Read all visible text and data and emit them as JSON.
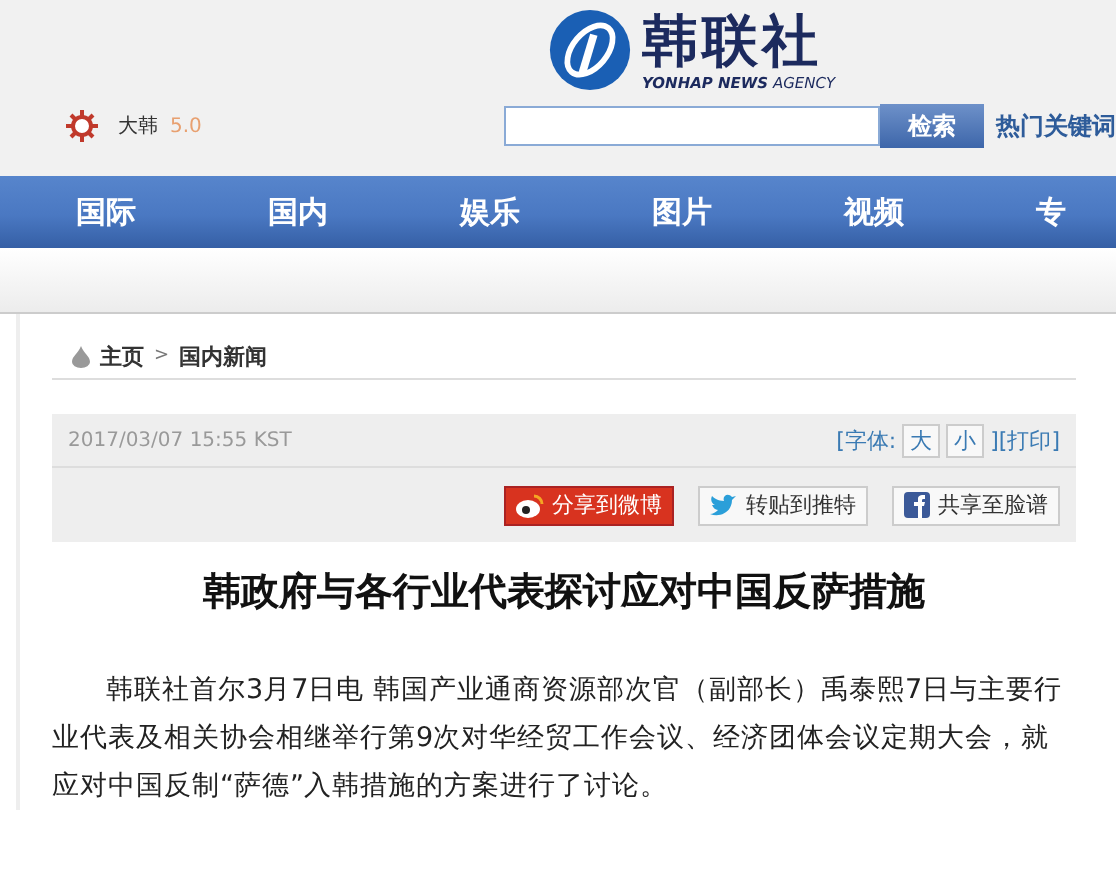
{
  "logo": {
    "name": "韩联社",
    "tagline_bold": "YONHAP NEWS",
    "tagline": "AGENCY"
  },
  "header": {
    "site_label": "大韩",
    "version": "5.0",
    "search": {
      "button": "检索"
    },
    "hot_keywords": "热门关键词"
  },
  "nav": [
    {
      "label": "国际"
    },
    {
      "label": "国内"
    },
    {
      "label": "娱乐"
    },
    {
      "label": "图片"
    },
    {
      "label": "视频"
    },
    {
      "label": "专"
    }
  ],
  "breadcrumb": [
    {
      "label": "主页"
    },
    {
      "label": "国内新闻"
    }
  ],
  "breadcrumb_separator": ">",
  "article": {
    "date": "2017/03/07 15:55 KST",
    "font_tools": {
      "open": "[字体:",
      "large": "大",
      "small": "小",
      "close": "][打印]"
    },
    "share": [
      {
        "kind": "weibo",
        "label": "分享到微博"
      },
      {
        "kind": "twitter",
        "label": "转贴到推特"
      },
      {
        "kind": "facebook",
        "label": "共享至脸谱"
      }
    ],
    "title": "韩政府与各行业代表探讨应对中国反萨措施",
    "body": "韩联社首尔3月7日电 韩国产业通商资源部次官（副部长）禹泰熙7日与主要行业代表及相关协会相继举行第9次对华经贸工作会议、经济团体会议定期大会，就应对中国反制“萨德”入韩措施的方案进行了讨论。"
  }
}
